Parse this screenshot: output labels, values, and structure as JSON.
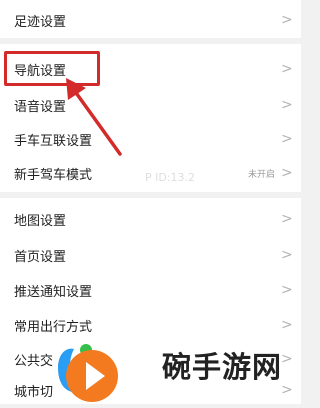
{
  "menu": {
    "items": [
      {
        "label": "足迹设置",
        "value": "",
        "chevron": ">"
      },
      {
        "label": "导航设置",
        "value": "",
        "chevron": ">"
      },
      {
        "label": "语音设置",
        "value": "",
        "chevron": ">"
      },
      {
        "label": "手车互联设置",
        "value": "",
        "chevron": ">"
      },
      {
        "label": "新手驾车模式",
        "value": "未开启",
        "chevron": ">"
      },
      {
        "label": "地图设置",
        "value": "",
        "chevron": ">"
      },
      {
        "label": "首页设置",
        "value": "",
        "chevron": ">"
      },
      {
        "label": "推送通知设置",
        "value": "",
        "chevron": ">"
      },
      {
        "label": "常用出行方式",
        "value": "",
        "chevron": ">"
      },
      {
        "label": "公共交",
        "value": "",
        "chevron": ">"
      },
      {
        "label": "城市切",
        "value": "",
        "chevron": ">"
      }
    ]
  },
  "watermark": "P ID:13.2",
  "logo": {
    "text": "碗手游网"
  },
  "colors": {
    "highlight": "#d32a2a",
    "logo_orange": "#f47a20",
    "logo_blue": "#2a9df4",
    "logo_green": "#35c04d"
  }
}
